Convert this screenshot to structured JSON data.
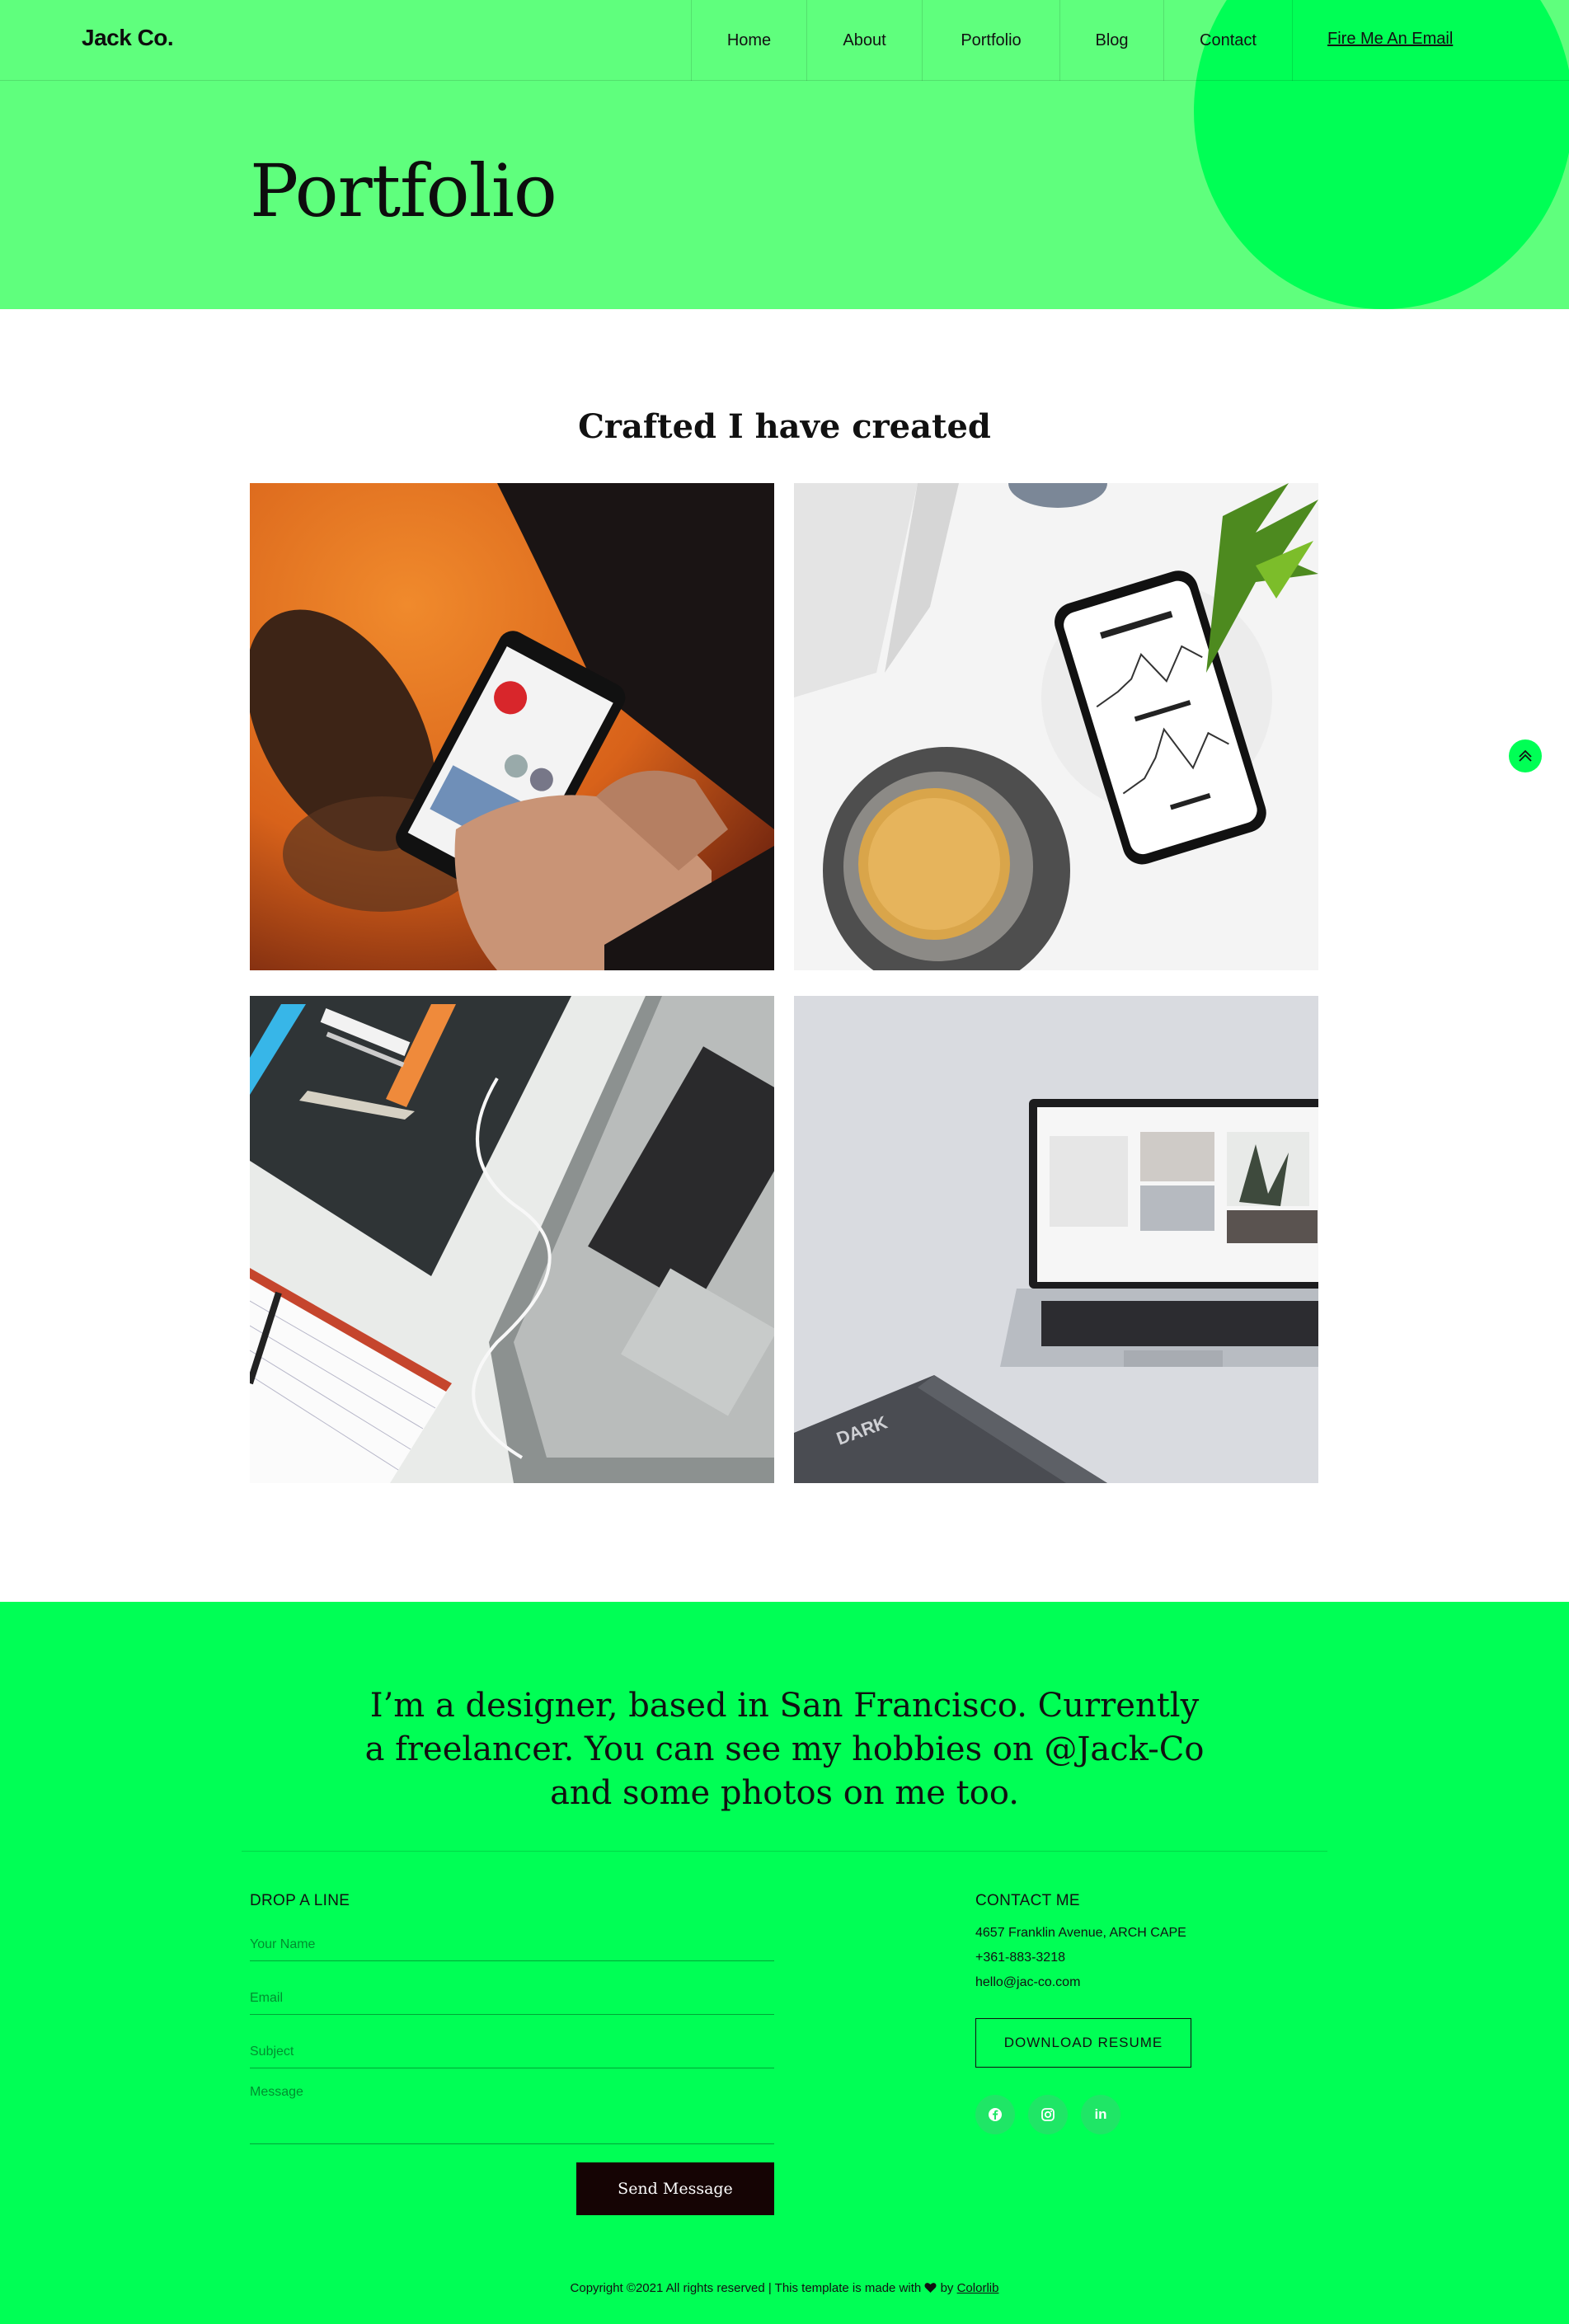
{
  "header": {
    "brand": "Jack Co.",
    "nav": [
      {
        "label": "Home"
      },
      {
        "label": "About"
      },
      {
        "label": "Portfolio"
      },
      {
        "label": "Blog"
      },
      {
        "label": "Contact"
      }
    ],
    "email_link": "Fire Me An Email"
  },
  "hero": {
    "title": "Portfolio"
  },
  "portfolio": {
    "heading": "Crafted I have created",
    "items": [
      {
        "icon": "phone-in-hands-photo"
      },
      {
        "icon": "phone-coffee-photo"
      },
      {
        "icon": "book-laptop-photo"
      },
      {
        "icon": "laptop-desk-photo"
      }
    ]
  },
  "back_to_top": {
    "icon": "chevron-up-icon"
  },
  "footer": {
    "intro_lines": [
      "I’m a designer, based in San Francisco. Currently",
      "a freelancer. You can see my hobbies on @Jack-Co",
      "and some photos on me too."
    ],
    "form": {
      "title": "DROP A LINE",
      "name_placeholder": "Your Name",
      "email_placeholder": "Email",
      "subject_placeholder": "Subject",
      "message_placeholder": "Message",
      "submit_label": "Send Message"
    },
    "contact": {
      "title": "CONTACT ME",
      "address": "4657 Franklin Avenue, ARCH CAPE",
      "phone": "+361-883-3218",
      "email": "hello@jac-co.com",
      "resume_label": "DOWNLOAD RESUME"
    },
    "social": [
      {
        "icon": "facebook-icon"
      },
      {
        "icon": "instagram-icon"
      },
      {
        "icon": "linkedin-icon",
        "text": "in"
      }
    ],
    "copyright_prefix": "Copyright ©2021 All rights reserved | This template is made with",
    "copyright_by": "by",
    "copyright_link": "Colorlib"
  },
  "colors": {
    "hero_bg": "#5fff7d",
    "accent": "#00ff55",
    "button_dark": "#150404"
  }
}
